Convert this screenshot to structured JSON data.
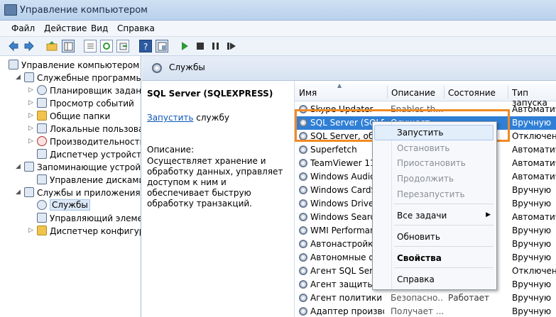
{
  "window": {
    "title": "Управление компьютером"
  },
  "menu": [
    "Файл",
    "Действие",
    "Вид",
    "Справка"
  ],
  "toolbar_icons": [
    "back-icon",
    "forward-icon",
    "up-folder-icon",
    "console-tree-icon",
    "properties-icon",
    "refresh-icon",
    "export-icon",
    "help-icon",
    "view-icon",
    "play-icon",
    "stop-icon",
    "pause-icon",
    "restart-icon"
  ],
  "tree": [
    {
      "label": "Управление компьютером (л",
      "level": 0,
      "arrow": "",
      "icon": "computer-icon"
    },
    {
      "label": "Служебные программы",
      "level": 1,
      "arrow": "◢",
      "icon": "tools-icon"
    },
    {
      "label": "Планировщик заданий",
      "level": 2,
      "arrow": "▷",
      "icon": "clock-icon"
    },
    {
      "label": "Просмотр событий",
      "level": 2,
      "arrow": "▷",
      "icon": "event-viewer-icon"
    },
    {
      "label": "Общие папки",
      "level": 2,
      "arrow": "▷",
      "icon": "shared-folder-icon"
    },
    {
      "label": "Локальные пользовате",
      "level": 2,
      "arrow": "▷",
      "icon": "users-icon"
    },
    {
      "label": "Производительность",
      "level": 2,
      "arrow": "▷",
      "icon": "performance-icon"
    },
    {
      "label": "Диспетчер устройств",
      "level": 2,
      "arrow": "",
      "icon": "device-manager-icon"
    },
    {
      "label": "Запоминающие устройст",
      "level": 1,
      "arrow": "◢",
      "icon": "storage-icon"
    },
    {
      "label": "Управление дисками",
      "level": 2,
      "arrow": "",
      "icon": "disk-icon"
    },
    {
      "label": "Службы и приложения",
      "level": 1,
      "arrow": "◢",
      "icon": "services-apps-icon"
    },
    {
      "label": "Службы",
      "level": 2,
      "arrow": "",
      "icon": "services-gear-icon",
      "selected": true
    },
    {
      "label": "Управляющий элемен",
      "level": 2,
      "arrow": "",
      "icon": "wmi-icon"
    },
    {
      "label": "Диспетчер конфигура",
      "level": 2,
      "arrow": "▷",
      "icon": "sql-config-icon"
    }
  ],
  "services_header": "Службы",
  "detail": {
    "name": "SQL Server (SQLEXPRESS)",
    "start_link": "Запустить",
    "start_suffix": " службу",
    "description_label": "Описание:",
    "description": "Осуществляет хранение и обработку данных, управляет доступом к ним и обеспечивает быструю обработку транзакций."
  },
  "columns": {
    "name": "Имя",
    "desc": "Описание",
    "state": "Состояние",
    "startup": "Тип запуска"
  },
  "rows": [
    {
      "name": "Skype Updater",
      "desc": "Enables th...",
      "state": "",
      "startup": "Автоматич"
    },
    {
      "name": "SQL Server (SQLEXPRESS)",
      "desc": "Осущест...",
      "state": "",
      "startup": "Вручную",
      "selected": true
    },
    {
      "name": "SQL Server, обозреватель",
      "desc": "",
      "state": "",
      "startup": "Отключена"
    },
    {
      "name": "Superfetch",
      "desc": "",
      "state": "",
      "startup": "Автоматич"
    },
    {
      "name": "TeamViewer 11",
      "desc": "",
      "state": "",
      "startup": "Автоматич"
    },
    {
      "name": "Windows Audio",
      "desc": "",
      "state": "",
      "startup": "Автоматич"
    },
    {
      "name": "Windows CardSpace",
      "desc": "",
      "state": "",
      "startup": "Вручную"
    },
    {
      "name": "Windows Driver Foundation",
      "desc": "",
      "state": "",
      "startup": "Вручную"
    },
    {
      "name": "Windows Search",
      "desc": "",
      "state": "",
      "startup": "Автоматич"
    },
    {
      "name": "WMI Performance Adapter",
      "desc": "",
      "state": "",
      "startup": "Вручную"
    },
    {
      "name": "Автонастройка WWAN",
      "desc": "",
      "state": "",
      "startup": "Вручную"
    },
    {
      "name": "Автономные файлы",
      "desc": "",
      "state": "",
      "startup": "Вручную"
    },
    {
      "name": "Агент SQL Server",
      "desc": "",
      "state": "",
      "startup": "Отключена"
    },
    {
      "name": "Агент защиты сетевого",
      "desc": "",
      "state": "",
      "startup": "Вручную"
    },
    {
      "name": "Агент политики IPsec",
      "desc": "Безопасно...",
      "state": "Работает",
      "startup": "Вручную"
    },
    {
      "name": "Адаптер производител",
      "desc": "Получает ...",
      "state": "",
      "startup": "Вручную"
    }
  ],
  "context_menu": {
    "start": "Запустить",
    "stop": "Остановить",
    "pause": "Приостановить",
    "resume": "Продолжить",
    "restart": "Перезапустить",
    "all_tasks": "Все задачи",
    "refresh": "Обновить",
    "properties": "Свойства",
    "help": "Справка"
  },
  "colors": {
    "highlight": "#2f7fd6",
    "callout": "#f08a24"
  }
}
